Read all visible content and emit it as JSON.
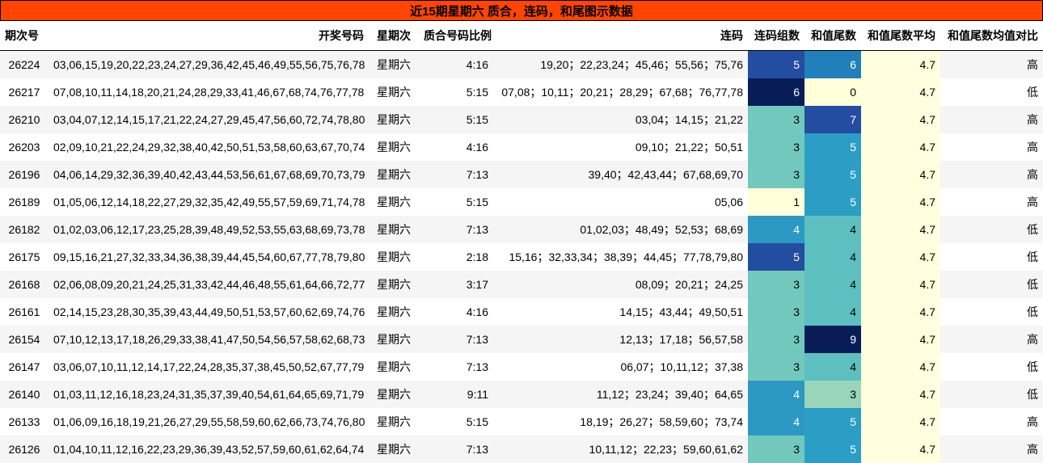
{
  "title": "近15期星期六 质合，连码，和尾图示数据",
  "headers": [
    "期次号",
    "开奖号码",
    "星期次",
    "质合号码比例",
    "连码",
    "连码组数",
    "和值尾数",
    "和值尾数平均",
    "和值尾数均值对比"
  ],
  "colors": {
    "title_bg": "#ff4500",
    "scale": {
      "0": "#ffffd9",
      "1": "#ffffd9",
      "3": "#73c8bd",
      "3b": "#99d6b9",
      "4": "#2c99c3",
      "5": "#2c99c3",
      "6": "#2c86be",
      "7": "#234da0",
      "9": "#081d58",
      "avg": "#ffffe0"
    }
  },
  "rows": [
    {
      "issue": "26224",
      "numbers": "03,06,15,19,20,22,23,24,27,29,36,42,45,46,49,55,56,75,76,78",
      "weekday": "星期六",
      "ratio": "4:16",
      "consecutive": "19,20；22,23,24；45,46；55,56；75,76",
      "groups": "5",
      "tail": "6",
      "avg": "4.7",
      "compare": "高",
      "groups_color": "#234da0",
      "tail_color": "#2180bb",
      "groups_text": "#ffffff",
      "tail_text": "#ffffff"
    },
    {
      "issue": "26217",
      "numbers": "07,08,10,11,14,18,20,21,24,28,29,33,41,46,67,68,74,76,77,78",
      "weekday": "星期六",
      "ratio": "5:15",
      "consecutive": "07,08；10,11；20,21；28,29；67,68；76,77,78",
      "groups": "6",
      "tail": "0",
      "avg": "4.7",
      "compare": "低",
      "groups_color": "#081d58",
      "tail_color": "#ffffd9",
      "groups_text": "#ffffff",
      "tail_text": "#000000"
    },
    {
      "issue": "26210",
      "numbers": "03,04,07,12,14,15,17,21,22,24,27,29,45,47,56,60,72,74,78,80",
      "weekday": "星期六",
      "ratio": "5:15",
      "consecutive": "03,04；14,15；21,22",
      "groups": "3",
      "tail": "7",
      "avg": "4.7",
      "compare": "高",
      "groups_color": "#73c8bd",
      "tail_color": "#234da0",
      "groups_text": "#000000",
      "tail_text": "#ffffff"
    },
    {
      "issue": "26203",
      "numbers": "02,09,10,21,22,24,29,32,38,40,42,50,51,53,58,60,63,67,70,74",
      "weekday": "星期六",
      "ratio": "4:16",
      "consecutive": "09,10；21,22；50,51",
      "groups": "3",
      "tail": "5",
      "avg": "4.7",
      "compare": "高",
      "groups_color": "#73c8bd",
      "tail_color": "#2c9ec6",
      "groups_text": "#000000",
      "tail_text": "#ffffff"
    },
    {
      "issue": "26196",
      "numbers": "04,06,14,29,32,36,39,40,42,43,44,53,56,61,67,68,69,70,73,79",
      "weekday": "星期六",
      "ratio": "7:13",
      "consecutive": "39,40；42,43,44；67,68,69,70",
      "groups": "3",
      "tail": "5",
      "avg": "4.7",
      "compare": "高",
      "groups_color": "#73c8bd",
      "tail_color": "#2c9ec6",
      "groups_text": "#000000",
      "tail_text": "#ffffff"
    },
    {
      "issue": "26189",
      "numbers": "01,05,06,12,14,18,22,27,29,32,35,42,49,55,57,59,69,71,74,78",
      "weekday": "星期六",
      "ratio": "5:15",
      "consecutive": "05,06",
      "groups": "1",
      "tail": "5",
      "avg": "4.7",
      "compare": "高",
      "groups_color": "#ffffd9",
      "tail_color": "#2c9ec6",
      "groups_text": "#000000",
      "tail_text": "#ffffff"
    },
    {
      "issue": "26182",
      "numbers": "01,02,03,06,12,17,23,25,28,39,48,49,52,53,55,63,68,69,73,78",
      "weekday": "星期六",
      "ratio": "7:13",
      "consecutive": "01,02,03；48,49；52,53；68,69",
      "groups": "4",
      "tail": "4",
      "avg": "4.7",
      "compare": "低",
      "groups_color": "#2c99c3",
      "tail_color": "#5dbfc0",
      "groups_text": "#ffffff",
      "tail_text": "#000000"
    },
    {
      "issue": "26175",
      "numbers": "09,15,16,21,27,32,33,34,36,38,39,44,45,54,60,67,77,78,79,80",
      "weekday": "星期六",
      "ratio": "2:18",
      "consecutive": "15,16；32,33,34；38,39；44,45；77,78,79,80",
      "groups": "5",
      "tail": "4",
      "avg": "4.7",
      "compare": "低",
      "groups_color": "#234da0",
      "tail_color": "#5dbfc0",
      "groups_text": "#ffffff",
      "tail_text": "#000000"
    },
    {
      "issue": "26168",
      "numbers": "02,06,08,09,20,21,24,25,31,33,42,44,46,48,55,61,64,66,72,77",
      "weekday": "星期六",
      "ratio": "3:17",
      "consecutive": "08,09；20,21；24,25",
      "groups": "3",
      "tail": "4",
      "avg": "4.7",
      "compare": "低",
      "groups_color": "#73c8bd",
      "tail_color": "#5dbfc0",
      "groups_text": "#000000",
      "tail_text": "#000000"
    },
    {
      "issue": "26161",
      "numbers": "02,14,15,23,28,30,35,39,43,44,49,50,51,53,57,60,62,69,74,76",
      "weekday": "星期六",
      "ratio": "4:16",
      "consecutive": "14,15；43,44；49,50,51",
      "groups": "3",
      "tail": "4",
      "avg": "4.7",
      "compare": "低",
      "groups_color": "#73c8bd",
      "tail_color": "#5dbfc0",
      "groups_text": "#000000",
      "tail_text": "#000000"
    },
    {
      "issue": "26154",
      "numbers": "07,10,12,13,17,18,26,29,33,38,41,47,50,54,56,57,58,62,68,73",
      "weekday": "星期六",
      "ratio": "7:13",
      "consecutive": "12,13；17,18；56,57,58",
      "groups": "3",
      "tail": "9",
      "avg": "4.7",
      "compare": "高",
      "groups_color": "#73c8bd",
      "tail_color": "#081d58",
      "groups_text": "#000000",
      "tail_text": "#ffffff"
    },
    {
      "issue": "26147",
      "numbers": "03,06,07,10,11,12,14,17,22,24,28,35,37,38,45,50,52,67,77,79",
      "weekday": "星期六",
      "ratio": "7:13",
      "consecutive": "06,07；10,11,12；37,38",
      "groups": "3",
      "tail": "4",
      "avg": "4.7",
      "compare": "低",
      "groups_color": "#73c8bd",
      "tail_color": "#5dbfc0",
      "groups_text": "#000000",
      "tail_text": "#000000"
    },
    {
      "issue": "26140",
      "numbers": "01,03,11,12,16,18,23,24,31,35,37,39,40,54,61,64,65,69,71,79",
      "weekday": "星期六",
      "ratio": "9:11",
      "consecutive": "11,12；23,24；39,40；64,65",
      "groups": "4",
      "tail": "3",
      "avg": "4.7",
      "compare": "低",
      "groups_color": "#2c99c3",
      "tail_color": "#99d6b9",
      "groups_text": "#ffffff",
      "tail_text": "#000000"
    },
    {
      "issue": "26133",
      "numbers": "01,06,09,16,18,19,21,26,27,29,55,58,59,60,62,66,73,74,76,80",
      "weekday": "星期六",
      "ratio": "5:15",
      "consecutive": "18,19；26,27；58,59,60；73,74",
      "groups": "4",
      "tail": "5",
      "avg": "4.7",
      "compare": "高",
      "groups_color": "#2c99c3",
      "tail_color": "#2c9ec6",
      "groups_text": "#ffffff",
      "tail_text": "#ffffff"
    },
    {
      "issue": "26126",
      "numbers": "01,04,10,11,12,16,22,23,29,36,39,43,52,57,59,60,61,62,64,74",
      "weekday": "星期六",
      "ratio": "7:13",
      "consecutive": "10,11,12；22,23；59,60,61,62",
      "groups": "3",
      "tail": "5",
      "avg": "4.7",
      "compare": "高",
      "groups_color": "#73c8bd",
      "tail_color": "#2c9ec6",
      "groups_text": "#000000",
      "tail_text": "#ffffff"
    }
  ]
}
